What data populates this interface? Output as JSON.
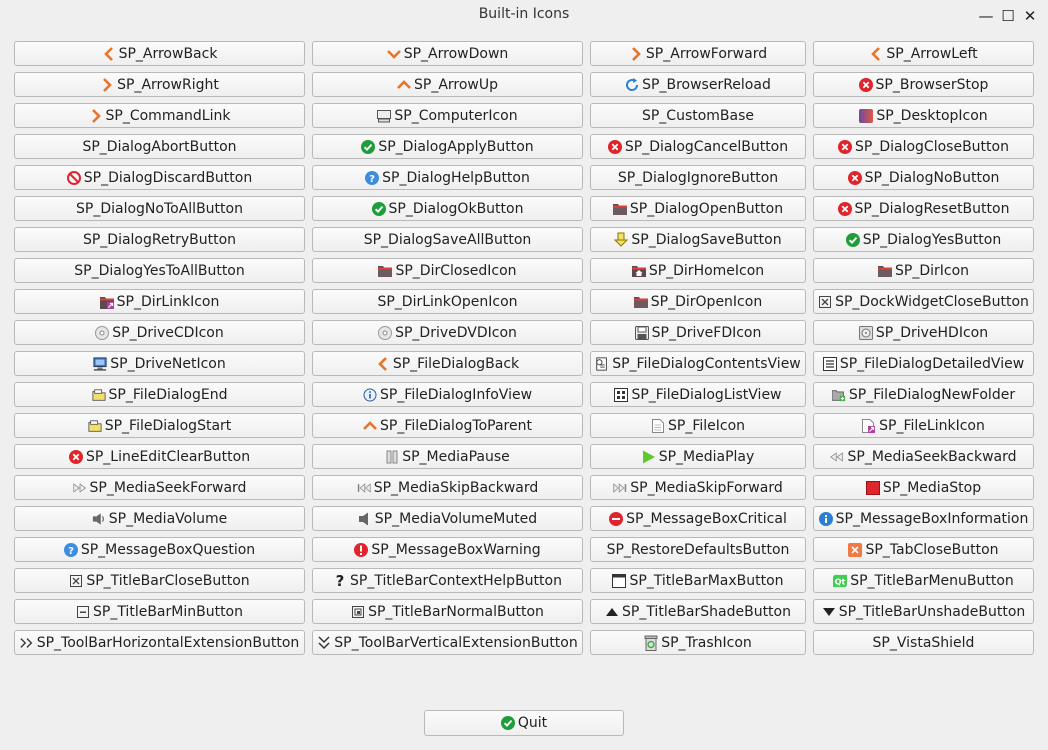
{
  "window": {
    "title": "Built-in Icons"
  },
  "controls": {
    "minimize": "—",
    "maximize": "☐",
    "close": "✕"
  },
  "buttons": [
    {
      "label": "SP_ArrowBack",
      "icon": "chev-left"
    },
    {
      "label": "SP_ArrowDown",
      "icon": "chev-down"
    },
    {
      "label": "SP_ArrowForward",
      "icon": "chev-right"
    },
    {
      "label": "SP_ArrowLeft",
      "icon": "chev-left"
    },
    {
      "label": "SP_ArrowRight",
      "icon": "chev-right"
    },
    {
      "label": "SP_ArrowUp",
      "icon": "chev-up"
    },
    {
      "label": "SP_BrowserReload",
      "icon": "reload"
    },
    {
      "label": "SP_BrowserStop",
      "icon": "red-x"
    },
    {
      "label": "SP_CommandLink",
      "icon": "chev-right"
    },
    {
      "label": "SP_ComputerIcon",
      "icon": "computer"
    },
    {
      "label": "SP_CustomBase",
      "icon": ""
    },
    {
      "label": "SP_DesktopIcon",
      "icon": "desktop"
    },
    {
      "label": "SP_DialogAbortButton",
      "icon": ""
    },
    {
      "label": "SP_DialogApplyButton",
      "icon": "green-check"
    },
    {
      "label": "SP_DialogCancelButton",
      "icon": "red-x"
    },
    {
      "label": "SP_DialogCloseButton",
      "icon": "red-x"
    },
    {
      "label": "SP_DialogDiscardButton",
      "icon": "discard"
    },
    {
      "label": "SP_DialogHelpButton",
      "icon": "help-blue"
    },
    {
      "label": "SP_DialogIgnoreButton",
      "icon": ""
    },
    {
      "label": "SP_DialogNoButton",
      "icon": "red-x"
    },
    {
      "label": "SP_DialogNoToAllButton",
      "icon": ""
    },
    {
      "label": "SP_DialogOkButton",
      "icon": "green-check"
    },
    {
      "label": "SP_DialogOpenButton",
      "icon": "folder"
    },
    {
      "label": "SP_DialogResetButton",
      "icon": "red-x"
    },
    {
      "label": "SP_DialogRetryButton",
      "icon": ""
    },
    {
      "label": "SP_DialogSaveAllButton",
      "icon": ""
    },
    {
      "label": "SP_DialogSaveButton",
      "icon": "save-down"
    },
    {
      "label": "SP_DialogYesButton",
      "icon": "green-check"
    },
    {
      "label": "SP_DialogYesToAllButton",
      "icon": ""
    },
    {
      "label": "SP_DirClosedIcon",
      "icon": "folder"
    },
    {
      "label": "SP_DirHomeIcon",
      "icon": "folder-home"
    },
    {
      "label": "SP_DirIcon",
      "icon": "folder"
    },
    {
      "label": "SP_DirLinkIcon",
      "icon": "folder-link"
    },
    {
      "label": "SP_DirLinkOpenIcon",
      "icon": ""
    },
    {
      "label": "SP_DirOpenIcon",
      "icon": "folder"
    },
    {
      "label": "SP_DockWidgetCloseButton",
      "icon": "small-x"
    },
    {
      "label": "SP_DriveCDIcon",
      "icon": "disc"
    },
    {
      "label": "SP_DriveDVDIcon",
      "icon": "disc"
    },
    {
      "label": "SP_DriveFDIcon",
      "icon": "floppy"
    },
    {
      "label": "SP_DriveHDIcon",
      "icon": "harddisk"
    },
    {
      "label": "SP_DriveNetIcon",
      "icon": "netdrive"
    },
    {
      "label": "SP_FileDialogBack",
      "icon": "chev-left"
    },
    {
      "label": "SP_FileDialogContentsView",
      "icon": "contents"
    },
    {
      "label": "SP_FileDialogDetailedView",
      "icon": "detailed"
    },
    {
      "label": "SP_FileDialogEnd",
      "icon": "folder-yellow"
    },
    {
      "label": "SP_FileDialogInfoView",
      "icon": "info-outline"
    },
    {
      "label": "SP_FileDialogListView",
      "icon": "listview"
    },
    {
      "label": "SP_FileDialogNewFolder",
      "icon": "newfolder"
    },
    {
      "label": "SP_FileDialogStart",
      "icon": "folder-yellow"
    },
    {
      "label": "SP_FileDialogToParent",
      "icon": "chev-up"
    },
    {
      "label": "SP_FileIcon",
      "icon": "file"
    },
    {
      "label": "SP_FileLinkIcon",
      "icon": "file-link"
    },
    {
      "label": "SP_LineEditClearButton",
      "icon": "red-x"
    },
    {
      "label": "SP_MediaPause",
      "icon": "pause"
    },
    {
      "label": "SP_MediaPlay",
      "icon": "play"
    },
    {
      "label": "SP_MediaSeekBackward",
      "icon": "seek-back"
    },
    {
      "label": "SP_MediaSeekForward",
      "icon": "seek-fwd"
    },
    {
      "label": "SP_MediaSkipBackward",
      "icon": "skip-back"
    },
    {
      "label": "SP_MediaSkipForward",
      "icon": "skip-fwd"
    },
    {
      "label": "SP_MediaStop",
      "icon": "stop"
    },
    {
      "label": "SP_MediaVolume",
      "icon": "volume"
    },
    {
      "label": "SP_MediaVolumeMuted",
      "icon": "volume-muted"
    },
    {
      "label": "SP_MessageBoxCritical",
      "icon": "critical"
    },
    {
      "label": "SP_MessageBoxInformation",
      "icon": "info-blue"
    },
    {
      "label": "SP_MessageBoxQuestion",
      "icon": "help-blue"
    },
    {
      "label": "SP_MessageBoxWarning",
      "icon": "warning"
    },
    {
      "label": "SP_RestoreDefaultsButton",
      "icon": ""
    },
    {
      "label": "SP_TabCloseButton",
      "icon": "tab-close"
    },
    {
      "label": "SP_TitleBarCloseButton",
      "icon": "small-x"
    },
    {
      "label": "SP_TitleBarContextHelpButton",
      "icon": "question"
    },
    {
      "label": "SP_TitleBarMaxButton",
      "icon": "maximize"
    },
    {
      "label": "SP_TitleBarMenuButton",
      "icon": "qt-logo"
    },
    {
      "label": "SP_TitleBarMinButton",
      "icon": "minimize"
    },
    {
      "label": "SP_TitleBarNormalButton",
      "icon": "normal"
    },
    {
      "label": "SP_TitleBarShadeButton",
      "icon": "shade"
    },
    {
      "label": "SP_TitleBarUnshadeButton",
      "icon": "unshade"
    },
    {
      "label": "SP_ToolBarHorizontalExtensionButton",
      "icon": "double-chev-right"
    },
    {
      "label": "SP_ToolBarVerticalExtensionButton",
      "icon": "double-chev-down"
    },
    {
      "label": "SP_TrashIcon",
      "icon": "trash"
    },
    {
      "label": "SP_VistaShield",
      "icon": ""
    }
  ],
  "quit": {
    "label": "Quit",
    "icon": "green-check"
  },
  "colors": {
    "red": "#e0242b",
    "green": "#1f9d3a",
    "blue": "#2a7fd4",
    "orange": "#e8742a"
  }
}
